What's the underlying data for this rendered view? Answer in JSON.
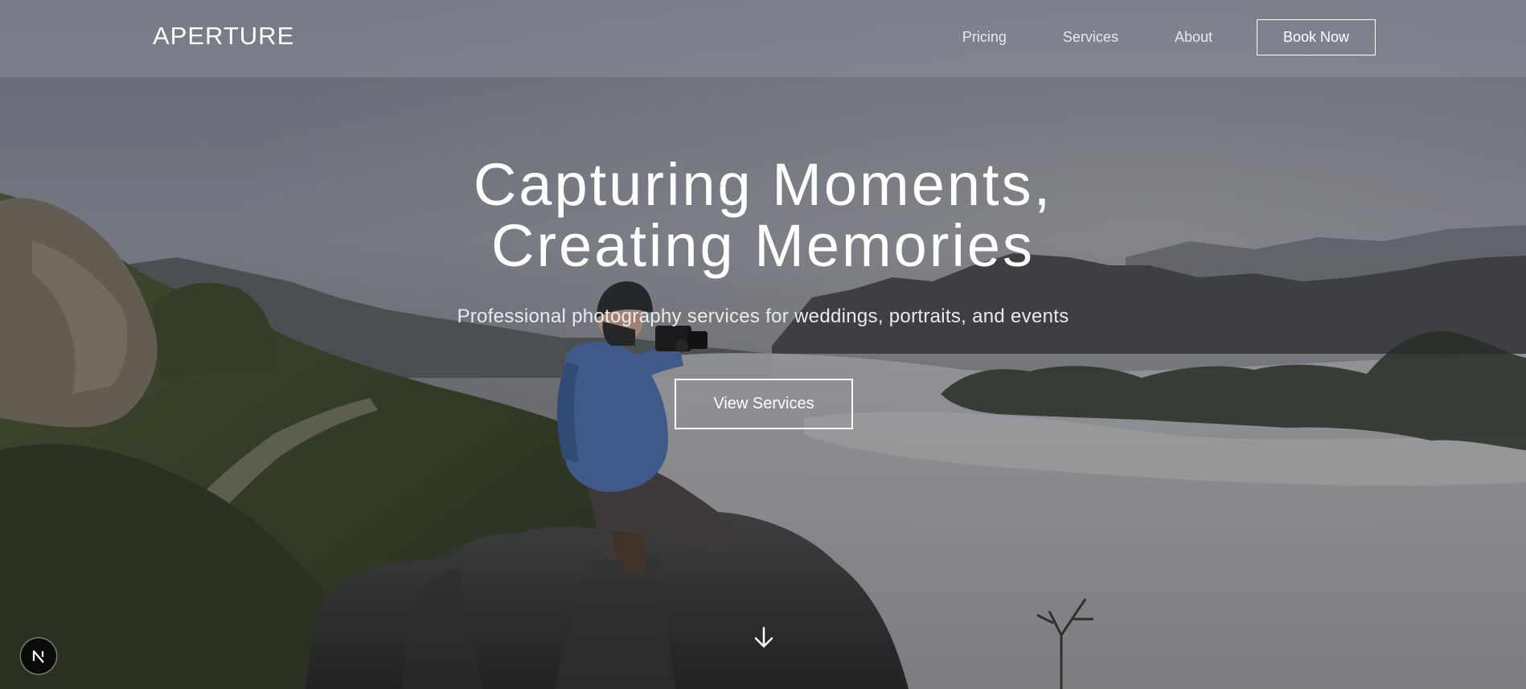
{
  "header": {
    "brand": "APERTURE",
    "nav": [
      {
        "label": "Pricing"
      },
      {
        "label": "Services"
      },
      {
        "label": "About"
      }
    ],
    "cta_label": "Book Now"
  },
  "hero": {
    "title_line_1": "Capturing Moments,",
    "title_line_2": "Creating Memories",
    "subtitle": "Professional photography services for weddings, portraits, and events",
    "button_label": "View Services",
    "background": "photographer-on-mountain-above-clouds",
    "scroll_icon": "arrow-down-icon"
  },
  "dev_badge": {
    "icon": "nextjs-logo-icon",
    "letter": "N"
  },
  "colors": {
    "text": "#ffffff",
    "header_bg": "rgba(150,156,168,0.38)",
    "badge_bg": "#0b0b0b"
  }
}
